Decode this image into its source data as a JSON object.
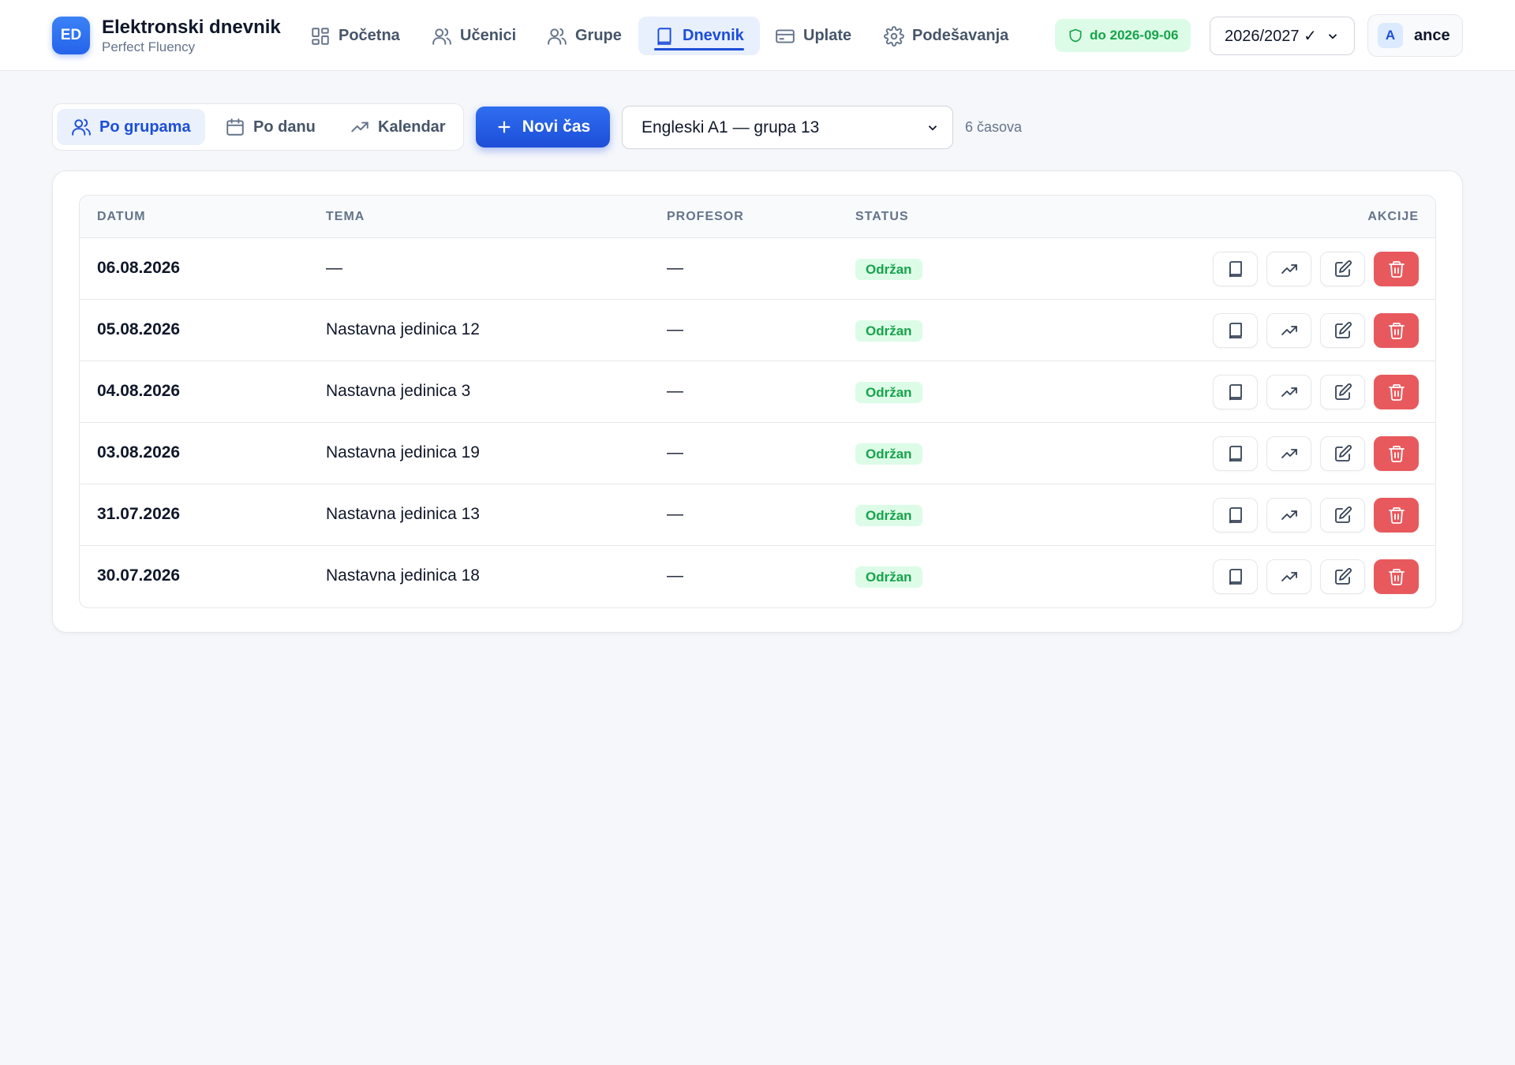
{
  "brand": {
    "logo": "ED",
    "title": "Elektronski dnevnik",
    "subtitle": "Perfect Fluency"
  },
  "nav": [
    {
      "label": "Početna",
      "icon": "dashboard-icon",
      "active": false
    },
    {
      "label": "Učenici",
      "icon": "users-icon",
      "active": false
    },
    {
      "label": "Grupe",
      "icon": "group-icon",
      "active": false
    },
    {
      "label": "Dnevnik",
      "icon": "book-icon",
      "active": true
    },
    {
      "label": "Uplate",
      "icon": "credit-card-icon",
      "active": false
    },
    {
      "label": "Podešavanja",
      "icon": "gear-icon",
      "active": false
    }
  ],
  "license": {
    "label": "do 2026-09-06",
    "icon": "shield-icon"
  },
  "year_select": {
    "value": "2026/2027 ✓"
  },
  "user": {
    "initial": "A",
    "name": "ance"
  },
  "view_tabs": [
    {
      "label": "Po grupama",
      "icon": "users-icon",
      "active": true
    },
    {
      "label": "Po danu",
      "icon": "calendar-icon",
      "active": false
    },
    {
      "label": "Kalendar",
      "icon": "trend-icon",
      "active": false
    }
  ],
  "new_button": {
    "label": "Novi čas"
  },
  "group_select": {
    "value": "Engleski A1 — grupa 13"
  },
  "count": "6 časova",
  "table": {
    "headers": {
      "date": "DATUM",
      "topic": "TEMA",
      "teacher": "PROFESOR",
      "status": "STATUS",
      "actions": "AKCIJE"
    },
    "rows": [
      {
        "date": "06.08.2026",
        "topic": "—",
        "teacher": "—",
        "status": "Održan"
      },
      {
        "date": "05.08.2026",
        "topic": "Nastavna jedinica 12",
        "teacher": "—",
        "status": "Održan"
      },
      {
        "date": "04.08.2026",
        "topic": "Nastavna jedinica 3",
        "teacher": "—",
        "status": "Održan"
      },
      {
        "date": "03.08.2026",
        "topic": "Nastavna jedinica 19",
        "teacher": "—",
        "status": "Održan"
      },
      {
        "date": "31.07.2026",
        "topic": "Nastavna jedinica 13",
        "teacher": "—",
        "status": "Održan"
      },
      {
        "date": "30.07.2026",
        "topic": "Nastavna jedinica 18",
        "teacher": "—",
        "status": "Održan"
      }
    ]
  },
  "colors": {
    "accent": "#1d4ed8",
    "success": "#16a34a",
    "danger": "#e8595d",
    "background": "#f5f7fb"
  }
}
